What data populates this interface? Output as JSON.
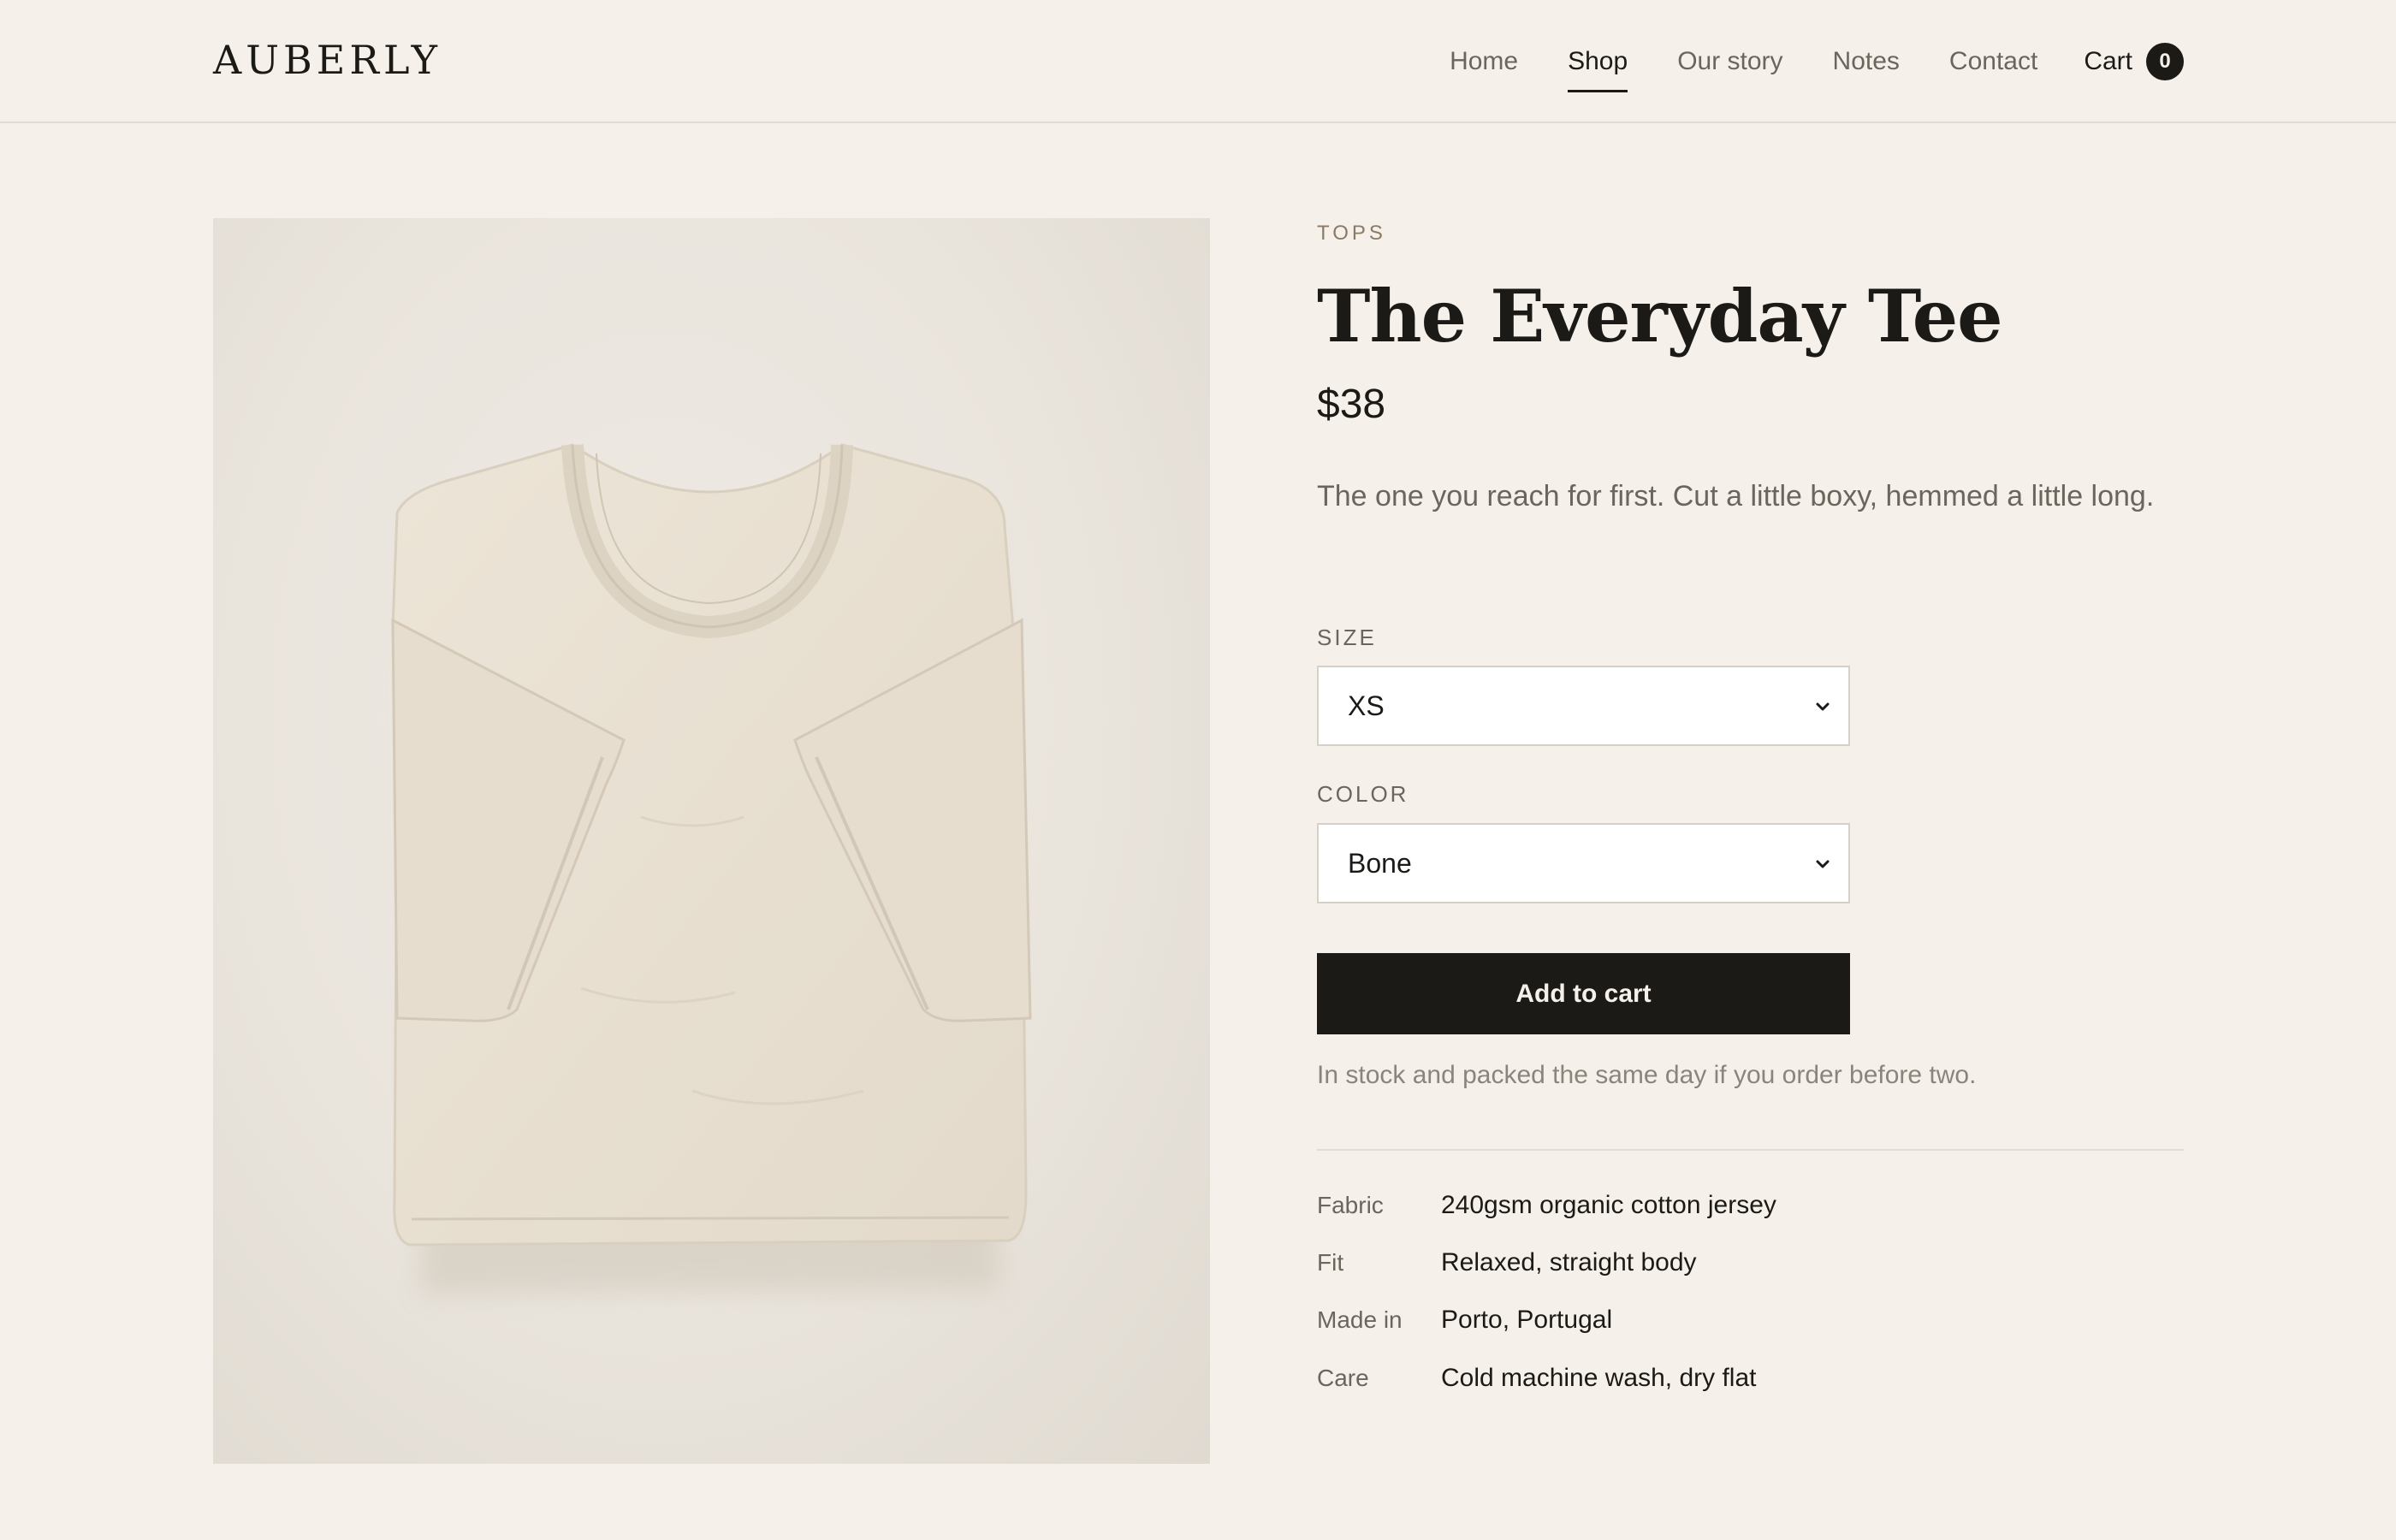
{
  "header": {
    "logo": "AUBERLY",
    "nav": [
      {
        "label": "Home",
        "active": false
      },
      {
        "label": "Shop",
        "active": true
      },
      {
        "label": "Our story",
        "active": false
      },
      {
        "label": "Notes",
        "active": false
      },
      {
        "label": "Contact",
        "active": false
      }
    ],
    "cart_label": "Cart",
    "cart_count": "0"
  },
  "product": {
    "category": "TOPS",
    "title": "The Everyday Tee",
    "price": "$38",
    "description": "The one you reach for first. Cut a little boxy, hemmed a little long.",
    "size_label": "SIZE",
    "size_value": "XS",
    "color_label": "COLOR",
    "color_value": "Bone",
    "add_to_cart": "Add to cart",
    "stock_note": "In stock and packed the same day if you order before two.",
    "specs": [
      {
        "label": "Fabric",
        "value": "240gsm organic cotton jersey"
      },
      {
        "label": "Fit",
        "value": "Relaxed, straight body"
      },
      {
        "label": "Made in",
        "value": "Porto, Portugal"
      },
      {
        "label": "Care",
        "value": "Cold machine wash, dry flat"
      }
    ]
  },
  "colors": {
    "background": "#f5f1ea",
    "ink": "#1c1a17",
    "muted": "#6b655d",
    "accent": "#8a7a66",
    "shirt": "#e9e1d4"
  }
}
